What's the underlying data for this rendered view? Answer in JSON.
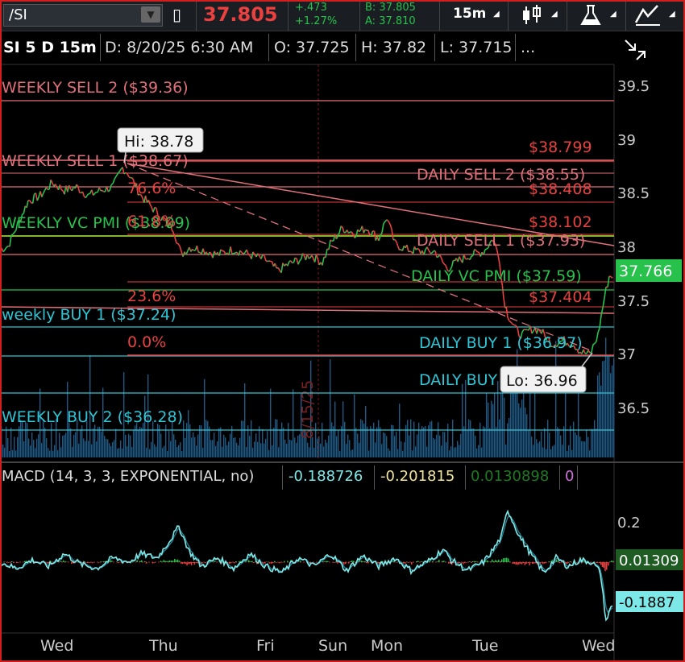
{
  "toolbar": {
    "symbol": "/SI",
    "last_price": "37.805",
    "net_change": "+.473",
    "pct_change": "+1.27%",
    "bid": "B: 37.805",
    "ask": "A: 37.810",
    "timeframe": "15m",
    "icons": [
      "dropdown-caret-icon",
      "phone-icon",
      "candlestick-icon",
      "flask-icon",
      "drawing-tools-icon",
      "expand-collapse-icon"
    ]
  },
  "info": {
    "title": "SI 5 D 15m",
    "date": "D: 8/20/25 6:30 AM",
    "open": "O: 37.725",
    "high": "H: 37.82",
    "low": "L: 37.715",
    "more": "..."
  },
  "price_axis": {
    "ticks": [
      "39.5",
      "39",
      "38.5",
      "38",
      "37.5",
      "37",
      "36.5"
    ],
    "current_tag": "37.766",
    "current_color": "#27c24c"
  },
  "levels": {
    "weekly_sell_2": "WEEKLY SELL 2 ($39.36)",
    "weekly_sell_1": "WEEKLY SELL 1 ($38.67)",
    "weekly_vc_pmi": "WEEKLY VC PMI ($38.09)",
    "weekly_buy_1": "weekly BUY 1 ($37.24)",
    "weekly_buy_2": "WEEKLY BUY 2 ($36.28)",
    "daily_sell_2": "DAILY SELL 2 ($38.55)",
    "daily_sell_1": "DAILY SELL 1 ($37.93)",
    "daily_vc_pmi": "DAILY VC PMI ($37.59)",
    "daily_buy_1": "DAILY BUY 1 ($36.97)",
    "daily_buy_2": "DAILY BUY 2 ($36.65)"
  },
  "fib": {
    "p1": "$38.799",
    "p2": "$38.408",
    "p3": "$38.102",
    "p4": "$37.404",
    "pct_76": "76.6%",
    "pct_61": "61.8%",
    "pct_23": "23.6%",
    "pct_0": "0.0%"
  },
  "bubbles": {
    "hi": "Hi: 38.78",
    "lo": "Lo: 36.96"
  },
  "date_marker": "8/15/25",
  "macd": {
    "title": "MACD (14, 3, 3, EXPONENTIAL, no)",
    "value": "-0.188726",
    "avg": "-0.201815",
    "diff": "0.0130898",
    "zero": "0",
    "ticks": [
      "0.2"
    ],
    "tag_diff": "0.01309",
    "tag_value": "-0.1887"
  },
  "x_axis": {
    "days": [
      "Wed",
      "Thu",
      "Fri",
      "Sun",
      "Mon",
      "Tue",
      "Wed"
    ]
  },
  "colors": {
    "up": "#27c24c",
    "down": "#e94040",
    "sell_line": "#e0707a",
    "buy_line": "#2ec6d6",
    "vc_line": "#9acd32",
    "volume": "#1d5a86"
  }
}
